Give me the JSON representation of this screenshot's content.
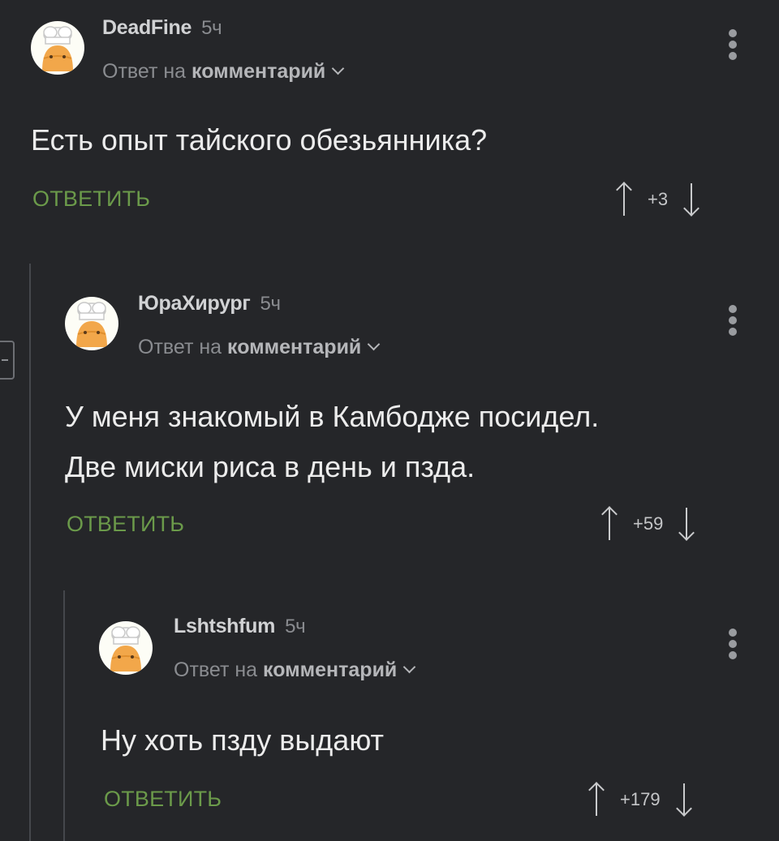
{
  "reply_label": "Ответ на",
  "reply_target": "комментарий",
  "reply_button_label": "ОТВЕТИТЬ",
  "colors": {
    "background": "#252629",
    "reply_button": "#6b9a4a",
    "author": "#d1d2d4",
    "muted": "#8a8c90"
  },
  "icons": {
    "avatar": "chef-avatar-icon",
    "menu": "more-vertical-icon",
    "upvote": "arrow-up-icon",
    "downvote": "arrow-down-icon",
    "reply_chevron": "chevron-down-icon",
    "collapse": "collapse-thread-icon"
  },
  "comments": [
    {
      "author": "DeadFine",
      "time": "5ч",
      "text_lines": [
        "Есть опыт тайского обезьянника?"
      ],
      "rating": "+3"
    },
    {
      "author": "ЮраХирург",
      "time": "5ч",
      "text_lines": [
        "У меня знакомый в Камбодже посидел.",
        "Две миски риса в день и пзда."
      ],
      "rating": "+59"
    },
    {
      "author": "Lshtshfum",
      "time": "5ч",
      "text_lines": [
        "Ну хоть пзду выдают"
      ],
      "rating": "+179"
    }
  ]
}
